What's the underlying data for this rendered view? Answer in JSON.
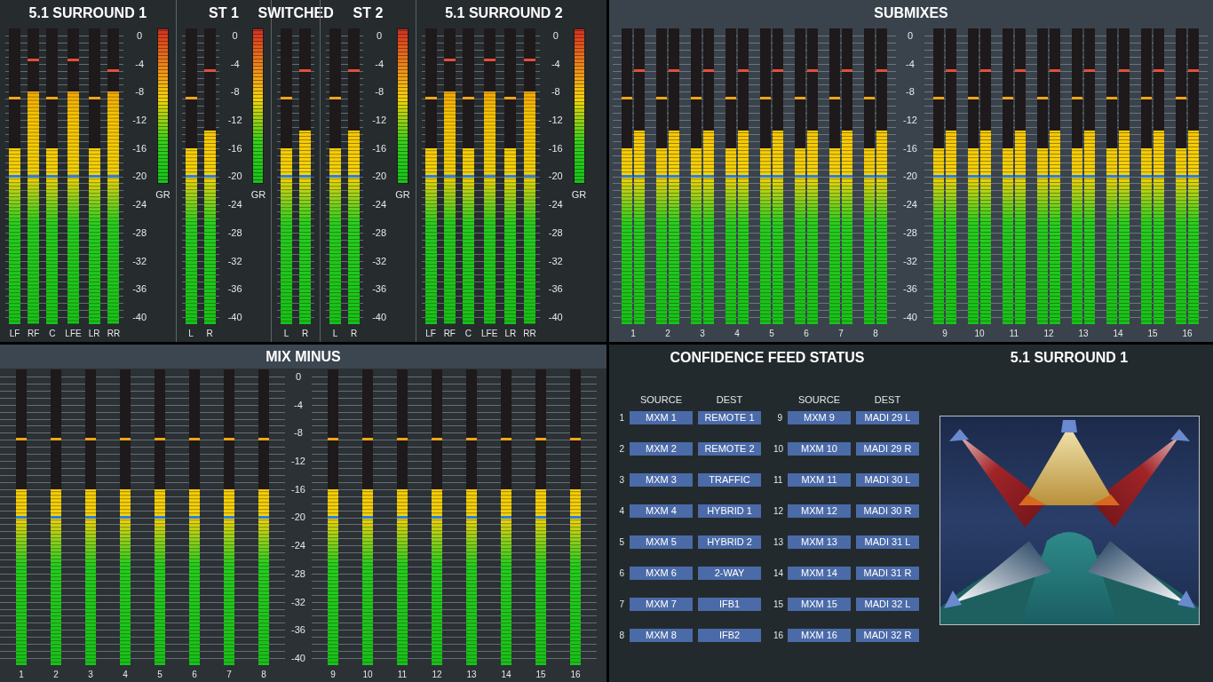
{
  "surround_monitor": {
    "groups": [
      {
        "title": "5.1 SURROUND 1",
        "meters": [
          {
            "label": "LF",
            "level": 0.6,
            "peak": {
              "level": 0.775
            }
          },
          {
            "label": "RF",
            "level": 0.8,
            "peak": {
              "level": 0.9125
            }
          },
          {
            "label": "C",
            "level": 0.6,
            "peak": {
              "level": 0.775
            }
          },
          {
            "label": "LFE",
            "level": 0.8,
            "peak": {
              "level": 0.9125
            }
          },
          {
            "label": "LR",
            "level": 0.6,
            "peak": {
              "level": 0.775
            }
          },
          {
            "label": "RR",
            "level": 0.8,
            "peak": {
              "level": 0.875
            }
          }
        ],
        "scale": [
          "0",
          "-4",
          "-8",
          "-12",
          "-16",
          "-20",
          "-24",
          "-28",
          "-32",
          "-36",
          "-40"
        ],
        "gr_meter": {
          "label": "GR",
          "level": 1
        }
      },
      {
        "title": "ST 1",
        "meters": [
          {
            "label": "L",
            "level": 0.6,
            "peak": {
              "level": 0.775
            }
          },
          {
            "label": "R",
            "level": 0.6625,
            "peak": {
              "level": 0.875
            }
          }
        ],
        "scale": [
          "0",
          "-4",
          "-8",
          "-12",
          "-16",
          "-20",
          "-24",
          "-28",
          "-32",
          "-36",
          "-40"
        ],
        "gr_meter": {
          "label": "GR",
          "level": 1
        }
      },
      {
        "title": "SWITCHED",
        "meters": [
          {
            "label": "L",
            "level": 0.6,
            "peak": {
              "level": 0.775
            }
          },
          {
            "label": "R",
            "level": 0.6625,
            "peak": {
              "level": 0.875
            }
          }
        ]
      },
      {
        "title": "ST 2",
        "meters": [
          {
            "label": "L",
            "level": 0.6,
            "peak": {
              "level": 0.775
            }
          },
          {
            "label": "R",
            "level": 0.6625,
            "peak": {
              "level": 0.875
            }
          }
        ],
        "scale": [
          "0",
          "-4",
          "-8",
          "-12",
          "-16",
          "-20",
          "-24",
          "-28",
          "-32",
          "-36",
          "-40"
        ],
        "gr_meter": {
          "label": "GR",
          "level": 1
        }
      },
      {
        "title": "5.1 SURROUND 2",
        "meters": [
          {
            "label": "LF",
            "level": 0.6,
            "peak": {
              "level": 0.775
            }
          },
          {
            "label": "RF",
            "level": 0.8,
            "peak": {
              "level": 0.9125
            }
          },
          {
            "label": "C",
            "level": 0.6,
            "peak": {
              "level": 0.775
            }
          },
          {
            "label": "LFE",
            "level": 0.8,
            "peak": {
              "level": 0.9125
            }
          },
          {
            "label": "LR",
            "level": 0.6,
            "peak": {
              "level": 0.775
            }
          },
          {
            "label": "RR",
            "level": 0.8,
            "peak": {
              "level": 0.9125
            }
          }
        ],
        "scale": [
          "0",
          "-4",
          "-8",
          "-12",
          "-16",
          "-20",
          "-24",
          "-28",
          "-32",
          "-36",
          "-40"
        ],
        "gr_meter": {
          "label": "GR",
          "level": 1
        }
      }
    ]
  },
  "submixes": {
    "title": "SUBMIXES",
    "groups": [
      {
        "channels": [
          {
            "label": "1",
            "meters": [
              {
                "level": 0.6,
                "peak": {
                  "level": 0.775
                }
              },
              {
                "level": 0.6625,
                "peak": {
                  "level": 0.875
                }
              }
            ]
          },
          {
            "label": "2",
            "meters": [
              {
                "level": 0.6,
                "peak": {
                  "level": 0.775
                }
              },
              {
                "level": 0.6625,
                "peak": {
                  "level": 0.875
                }
              }
            ]
          },
          {
            "label": "3",
            "meters": [
              {
                "level": 0.6,
                "peak": {
                  "level": 0.775
                }
              },
              {
                "level": 0.6625,
                "peak": {
                  "level": 0.875
                }
              }
            ]
          },
          {
            "label": "4",
            "meters": [
              {
                "level": 0.6,
                "peak": {
                  "level": 0.775
                }
              },
              {
                "level": 0.6625,
                "peak": {
                  "level": 0.875
                }
              }
            ]
          },
          {
            "label": "5",
            "meters": [
              {
                "level": 0.6,
                "peak": {
                  "level": 0.775
                }
              },
              {
                "level": 0.6625,
                "peak": {
                  "level": 0.875
                }
              }
            ]
          },
          {
            "label": "6",
            "meters": [
              {
                "level": 0.6,
                "peak": {
                  "level": 0.775
                }
              },
              {
                "level": 0.6625,
                "peak": {
                  "level": 0.875
                }
              }
            ]
          },
          {
            "label": "7",
            "meters": [
              {
                "level": 0.6,
                "peak": {
                  "level": 0.775
                }
              },
              {
                "level": 0.6625,
                "peak": {
                  "level": 0.875
                }
              }
            ]
          },
          {
            "label": "8",
            "meters": [
              {
                "level": 0.6,
                "peak": {
                  "level": 0.775
                }
              },
              {
                "level": 0.6625,
                "peak": {
                  "level": 0.875
                }
              }
            ]
          }
        ],
        "scale": [
          "0",
          "-4",
          "-8",
          "-12",
          "-16",
          "-20",
          "-24",
          "-28",
          "-32",
          "-36",
          "-40"
        ]
      },
      {
        "channels": [
          {
            "label": "9",
            "meters": [
              {
                "level": 0.6,
                "peak": {
                  "level": 0.775
                }
              },
              {
                "level": 0.6625,
                "peak": {
                  "level": 0.875
                }
              }
            ]
          },
          {
            "label": "10",
            "meters": [
              {
                "level": 0.6,
                "peak": {
                  "level": 0.775
                }
              },
              {
                "level": 0.6625,
                "peak": {
                  "level": 0.875
                }
              }
            ]
          },
          {
            "label": "11",
            "meters": [
              {
                "level": 0.6,
                "peak": {
                  "level": 0.775
                }
              },
              {
                "level": 0.6625,
                "peak": {
                  "level": 0.875
                }
              }
            ]
          },
          {
            "label": "12",
            "meters": [
              {
                "level": 0.6,
                "peak": {
                  "level": 0.775
                }
              },
              {
                "level": 0.6625,
                "peak": {
                  "level": 0.875
                }
              }
            ]
          },
          {
            "label": "13",
            "meters": [
              {
                "level": 0.6,
                "peak": {
                  "level": 0.775
                }
              },
              {
                "level": 0.6625,
                "peak": {
                  "level": 0.875
                }
              }
            ]
          },
          {
            "label": "14",
            "meters": [
              {
                "level": 0.6,
                "peak": {
                  "level": 0.775
                }
              },
              {
                "level": 0.6625,
                "peak": {
                  "level": 0.875
                }
              }
            ]
          },
          {
            "label": "15",
            "meters": [
              {
                "level": 0.6,
                "peak": {
                  "level": 0.775
                }
              },
              {
                "level": 0.6625,
                "peak": {
                  "level": 0.875
                }
              }
            ]
          },
          {
            "label": "16",
            "meters": [
              {
                "level": 0.6,
                "peak": {
                  "level": 0.775
                }
              },
              {
                "level": 0.6625,
                "peak": {
                  "level": 0.875
                }
              }
            ]
          }
        ]
      }
    ]
  },
  "mix_minus": {
    "title": "MIX MINUS",
    "groups": [
      {
        "meters": [
          {
            "label": "1",
            "level": 0.6,
            "peak": {
              "level": 0.775
            }
          },
          {
            "label": "2",
            "level": 0.6,
            "peak": {
              "level": 0.775
            }
          },
          {
            "label": "3",
            "level": 0.6,
            "peak": {
              "level": 0.775
            }
          },
          {
            "label": "4",
            "level": 0.6,
            "peak": {
              "level": 0.775
            }
          },
          {
            "label": "5",
            "level": 0.6,
            "peak": {
              "level": 0.775
            }
          },
          {
            "label": "6",
            "level": 0.6,
            "peak": {
              "level": 0.775
            }
          },
          {
            "label": "7",
            "level": 0.6,
            "peak": {
              "level": 0.775
            }
          },
          {
            "label": "8",
            "level": 0.6,
            "peak": {
              "level": 0.775
            }
          }
        ],
        "scale": [
          "0",
          "-4",
          "-8",
          "-12",
          "-16",
          "-20",
          "-24",
          "-28",
          "-32",
          "-36",
          "-40"
        ]
      },
      {
        "meters": [
          {
            "label": "9",
            "level": 0.6,
            "peak": {
              "level": 0.775
            }
          },
          {
            "label": "10",
            "level": 0.6,
            "peak": {
              "level": 0.775
            }
          },
          {
            "label": "11",
            "level": 0.6,
            "peak": {
              "level": 0.775
            }
          },
          {
            "label": "12",
            "level": 0.6,
            "peak": {
              "level": 0.775
            }
          },
          {
            "label": "13",
            "level": 0.6,
            "peak": {
              "level": 0.775
            }
          },
          {
            "label": "14",
            "level": 0.6,
            "peak": {
              "level": 0.775
            }
          },
          {
            "label": "15",
            "level": 0.6,
            "peak": {
              "level": 0.775
            }
          },
          {
            "label": "16",
            "level": 0.6,
            "peak": {
              "level": 0.775
            }
          }
        ]
      }
    ]
  },
  "confidence_feed_status": {
    "title": "CONFIDENCE FEED STATUS",
    "columns": [
      {
        "headers": [
          "SOURCE",
          "DEST"
        ],
        "rows": [
          {
            "number": "1",
            "source": "MXM 1",
            "dest": "REMOTE 1"
          },
          {
            "number": "2",
            "source": "MXM 2",
            "dest": "REMOTE 2"
          },
          {
            "number": "3",
            "source": "MXM 3",
            "dest": "TRAFFIC"
          },
          {
            "number": "4",
            "source": "MXM 4",
            "dest": "HYBRID 1"
          },
          {
            "number": "5",
            "source": "MXM 5",
            "dest": "HYBRID 2"
          },
          {
            "number": "6",
            "source": "MXM 6",
            "dest": "2-WAY"
          },
          {
            "number": "7",
            "source": "MXM 7",
            "dest": "IFB1"
          },
          {
            "number": "8",
            "source": "MXM 8",
            "dest": "IFB2"
          }
        ]
      },
      {
        "headers": [
          "SOURCE",
          "DEST"
        ],
        "rows": [
          {
            "number": "9",
            "source": "MXM 9",
            "dest": "MADI 29 L"
          },
          {
            "number": "10",
            "source": "MXM 10",
            "dest": "MADI 29 R"
          },
          {
            "number": "11",
            "source": "MXM 11",
            "dest": "MADI 30 L"
          },
          {
            "number": "12",
            "source": "MXM 12",
            "dest": "MADI 30 R"
          },
          {
            "number": "13",
            "source": "MXM 13",
            "dest": "MADI 31 L"
          },
          {
            "number": "14",
            "source": "MXM 14",
            "dest": "MADI 31 R"
          },
          {
            "number": "15",
            "source": "MXM 15",
            "dest": "MADI 32 L"
          },
          {
            "number": "16",
            "source": "MXM 16",
            "dest": "MADI 32 R"
          }
        ]
      }
    ]
  },
  "surround_view": {
    "title": "5.1 SURROUND 1"
  }
}
